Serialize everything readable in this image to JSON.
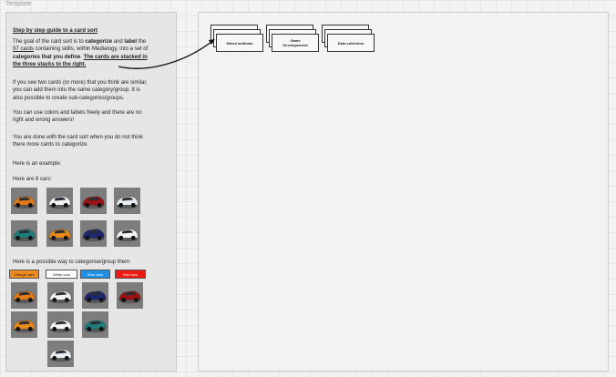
{
  "frame": {
    "label": "Template"
  },
  "guide": {
    "title": "Step by step guide to a card sort",
    "para1": [
      [
        "The goal of the card sort is to ",
        {
          "b": "categorize"
        },
        " and ",
        {
          "b": "label"
        },
        " the"
      ],
      [
        {
          "u": "97 cards"
        },
        " containing skills, within Medialogy, into a set of"
      ],
      [
        {
          "b": "categories that you define"
        },
        ". ",
        {
          "bu": "The cards are stacked in"
        }
      ],
      [
        {
          "bu": "the three stacks to the right."
        }
      ]
    ],
    "para2": [
      "If you see two cards (or more) that you think are similar,",
      "you can add them into the same category/group. It is",
      "also possible to create sub-categories/groups."
    ],
    "para3": [
      "You can use colors and labels freely and there are no",
      "right and wrong answers!"
    ],
    "para4": [
      "You are done with the card sort when you do not think",
      "there more cards to categorize."
    ],
    "example_intro": "Here is an example:",
    "cars_intro": "Here are 8 cars:",
    "group_intro": "Here is a possible way to categorise/group them:"
  },
  "cars_grid": [
    {
      "color": "#e07a16",
      "icon": "car-icon"
    },
    {
      "color": "#f2f2f2",
      "icon": "car-icon"
    },
    {
      "color": "#9b1212",
      "icon": "car-icon"
    },
    {
      "color": "#e9eef2",
      "icon": "car-icon"
    },
    {
      "color": "#1e7d7a",
      "icon": "car-icon"
    },
    {
      "color": "#e8891a",
      "icon": "car-icon"
    },
    {
      "color": "#1d2670",
      "icon": "car-icon"
    },
    {
      "color": "#f4f4f4",
      "icon": "car-icon"
    }
  ],
  "groups": [
    {
      "label": "Orange cars",
      "bg": "#f08a1c",
      "text": "#222222",
      "cars": [
        "#e07a16",
        "#e8891a"
      ]
    },
    {
      "label": "White cars",
      "bg": "#ffffff",
      "text": "#222222",
      "cars": [
        "#f2f2f2",
        "#f4f4f4",
        "#e9eef2"
      ]
    },
    {
      "label": "Blue cars",
      "bg": "#1f8fe6",
      "text": "#ffffff",
      "cars": [
        "#1d2670",
        "#1e7d7a"
      ]
    },
    {
      "label": "Red cars",
      "bg": "#ef1b12",
      "text": "#ffffff",
      "cars": [
        "#9b1212"
      ]
    }
  ],
  "stacks": [
    {
      "label": "Mixed methods"
    },
    {
      "label": "Game\nDevelopement"
    },
    {
      "label": "Data collection"
    }
  ]
}
